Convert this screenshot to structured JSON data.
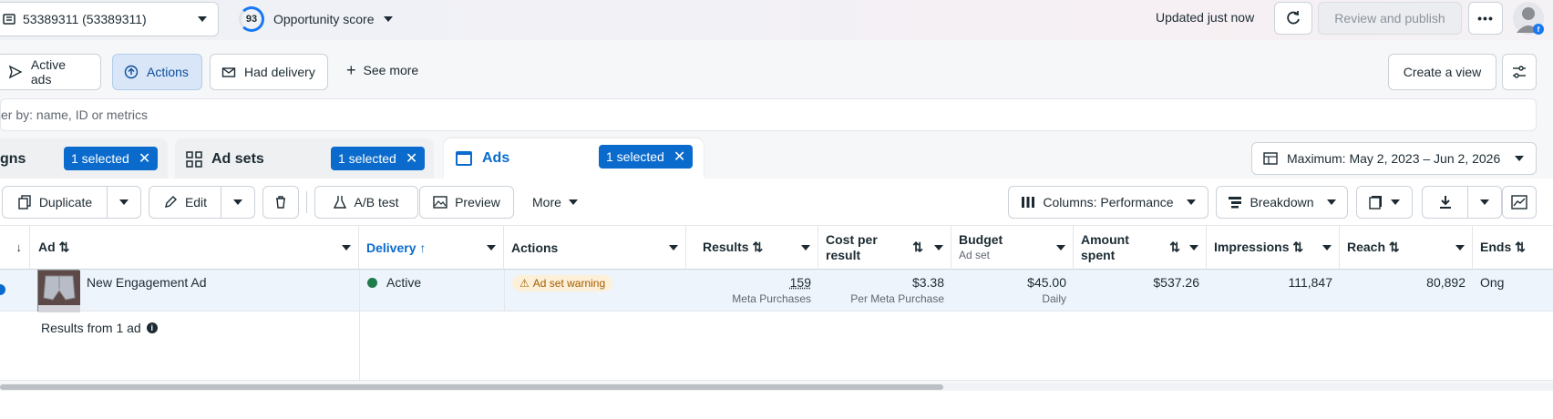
{
  "topbar": {
    "account_label": "53389311 (53389311)",
    "opportunity_score": "93",
    "opportunity_label": "Opportunity score",
    "updated_text": "Updated just now",
    "review_publish": "Review and publish"
  },
  "filters": {
    "pills": [
      {
        "label": "Active ads",
        "selected": false
      },
      {
        "label": "Actions",
        "selected": true
      },
      {
        "label": "Had delivery",
        "selected": false
      }
    ],
    "see_more": "See more",
    "create_view": "Create a view"
  },
  "search": {
    "placeholder": "er by: name, ID or metrics"
  },
  "tabs": {
    "campaigns_label": "gns",
    "campaigns_chip": "1 selected",
    "adsets_label": "Ad sets",
    "adsets_chip": "1 selected",
    "ads_label": "Ads",
    "ads_chip": "1 selected",
    "date_range": "Maximum: May 2, 2023 – Jun 2, 2026"
  },
  "toolbar": {
    "duplicate": "Duplicate",
    "edit": "Edit",
    "ab_test": "A/B test",
    "preview": "Preview",
    "more": "More",
    "columns": "Columns: Performance",
    "breakdown": "Breakdown"
  },
  "table": {
    "headers": {
      "ad": "Ad",
      "delivery": "Delivery",
      "actions": "Actions",
      "results": "Results",
      "cost_per_result_l1": "Cost per",
      "cost_per_result_l2": "result",
      "budget": "Budget",
      "budget_sub": "Ad set",
      "amount_spent_l1": "Amount",
      "amount_spent_l2": "spent",
      "impressions": "Impressions",
      "reach": "Reach",
      "ends": "Ends"
    },
    "row": {
      "ad_name": "New Engagement Ad",
      "delivery": "Active",
      "actions_badge": "Ad set warning",
      "results": "159",
      "results_sub": "Meta Purchases",
      "cost_per_result": "$3.38",
      "cost_per_result_sub": "Per Meta Purchase",
      "budget": "$45.00",
      "budget_sub": "Daily",
      "amount_spent": "$537.26",
      "impressions": "111,847",
      "reach": "80,892",
      "ends": "Ong"
    },
    "summary": "Results from 1 ad"
  },
  "colors": {
    "accent": "#0a6bcc",
    "active_dot": "#1f7a4c",
    "warning": "#a25d00"
  }
}
